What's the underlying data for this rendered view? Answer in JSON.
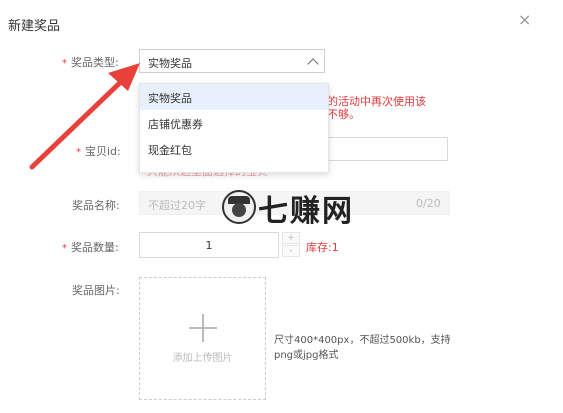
{
  "dialog": {
    "title": "新建奖品",
    "close_glyph": "×"
  },
  "prize_type": {
    "label": "奖品类型:",
    "value": "实物奖品"
  },
  "dropdown": {
    "options": [
      "实物奖品",
      "店铺优惠券",
      "现金红包"
    ]
  },
  "hint_lines": [
    "他的活动中再次使用该",
    "够不够。"
  ],
  "item_id": {
    "label": "宝贝id:",
    "under_text": "只能从这里面选择的宝贝"
  },
  "prize_name": {
    "label": "奖品名称:",
    "placeholder": "不超过20字",
    "counter": "0/20"
  },
  "prize_qty": {
    "label": "奖品数量:",
    "value": "1",
    "stock": "库存:1"
  },
  "prize_image": {
    "label": "奖品图片:",
    "upload_text": "添加上传图片",
    "plus": "+"
  },
  "size_note": "尺寸400*400px，不超过500kb，支持png或jpg格式",
  "watermark": {
    "text": "七赚网"
  },
  "required_mark": "*",
  "colors": {
    "accent": "#e4393c",
    "selected_bg": "#e8f1fb"
  }
}
